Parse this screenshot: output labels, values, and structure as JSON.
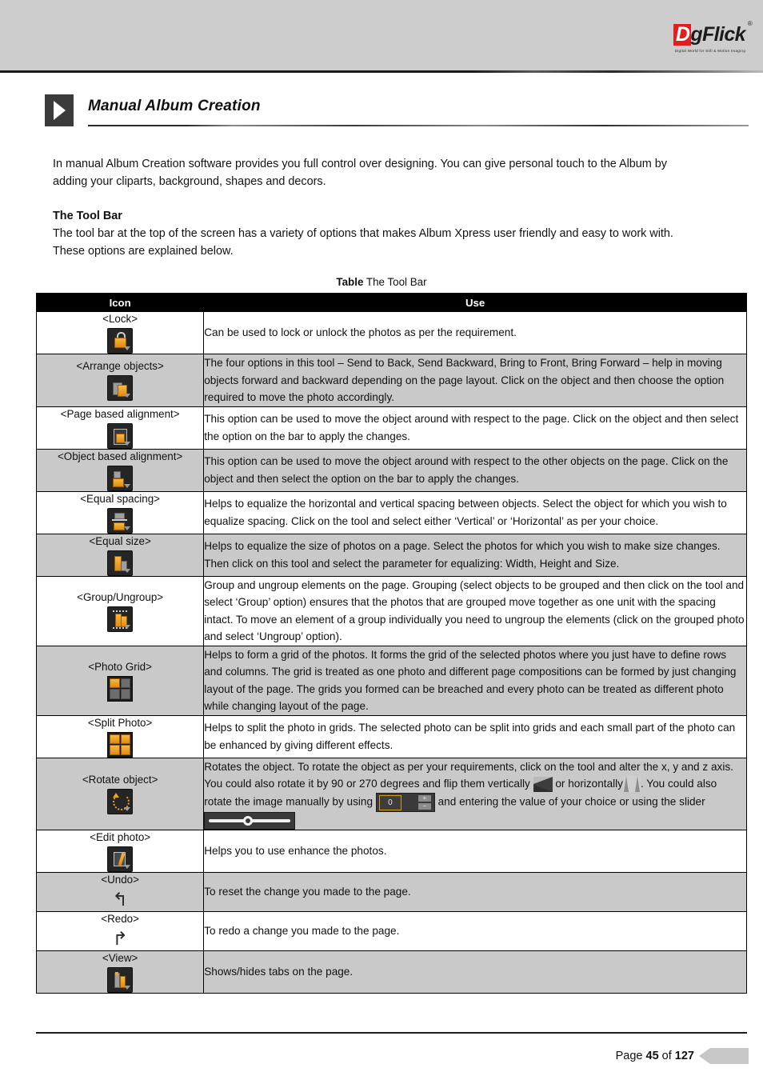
{
  "header": {
    "logo": {
      "first_letter": "D",
      "rest": "gFlick",
      "registered": "®",
      "tagline": "Digital World for Still & Motion Imaging"
    }
  },
  "chapter": {
    "title": "Manual Album Creation",
    "marker_icon": "play-triangle-icon"
  },
  "body": {
    "intro": "In manual Album Creation software provides you full control over designing. You can give personal touch to the Album by adding your cliparts, background, shapes and decors.",
    "toolbar_heading": "The Tool Bar",
    "toolbar_para": "The tool bar at the top of the screen has a variety of options that makes Album Xpress user friendly and easy to work with. These options are explained below."
  },
  "table": {
    "caption_bold": "Table",
    "caption_rest": " The Tool Bar",
    "columns": [
      "Icon",
      "Use"
    ],
    "rows": [
      {
        "label": "<Lock>",
        "icon": "lock-icon",
        "use": "Can be used to lock or unlock the photos as per the requirement."
      },
      {
        "label": "<Arrange objects>",
        "icon": "arrange-objects-icon",
        "use": "The four options in this tool – Send to Back, Send Backward, Bring to Front, Bring Forward – help in moving objects forward and backward depending on the page layout. Click on the object and then choose the option required to move the photo accordingly."
      },
      {
        "label": "<Page based alignment>",
        "icon": "page-based-alignment-icon",
        "use": "This option can be used to move the object around with respect to the page. Click on the object and then select the option on the bar to apply the changes."
      },
      {
        "label": "<Object based alignment>",
        "icon": "object-based-alignment-icon",
        "use": "This option can be used to move the object around with respect to the other objects on the page. Click on the object and then select the option on the bar to apply the changes."
      },
      {
        "label": "<Equal spacing>",
        "icon": "equal-spacing-icon",
        "use": "Helps to equalize the horizontal and vertical spacing between objects. Select the object for which you wish to equalize spacing. Click on the tool and select either ‘Vertical’ or ‘Horizontal’ as per your choice."
      },
      {
        "label": "<Equal size>",
        "icon": "equal-size-icon",
        "use": "Helps to equalize the size of photos on a page. Select the photos for which you wish to make size changes. Then click on this tool and select the parameter for equalizing: Width, Height and Size."
      },
      {
        "label": "<Group/Ungroup>",
        "icon": "group-ungroup-icon",
        "use": "Group and ungroup elements on the page. Grouping (select objects to be grouped and then click on the tool and select ‘Group’ option) ensures that the photos that are grouped move together as one unit with the spacing intact. To move an element of a group individually you need to ungroup the elements (click on the grouped photo and select ‘Ungroup’ option)."
      },
      {
        "label": "<Photo Grid>",
        "icon": "photo-grid-icon",
        "use": "Helps to form a grid of the photos. It forms the grid of the selected photos where you just have to define rows and columns. The grid is treated as one photo and different page compositions can be formed by just changing layout of the page. The grids you formed can be breached and every photo can be treated as different photo while changing layout of the page."
      },
      {
        "label": "<Split Photo>",
        "icon": "split-photo-icon",
        "use": "Helps to split the photo in grids. The selected photo can be split into grids and each small part of the photo can be enhanced by giving different effects."
      },
      {
        "label": "<Rotate object>",
        "icon": "rotate-object-icon",
        "use_segments": {
          "s1": "Rotates the object. To rotate the object as per your requirements, click on the tool and alter the x, y and z axis. You could also rotate it by 90 or 270 degrees and flip them vertically ",
          "s2": " or horizontally",
          "s3": ". You could also rotate the image manually by using ",
          "s4": " and entering the value of your choice or using the slider ",
          "spinner_value": "0",
          "spinner_up": "+",
          "spinner_down": "−"
        }
      },
      {
        "label": "<Edit photo>",
        "icon": "edit-photo-icon",
        "use": "Helps you to use enhance the photos."
      },
      {
        "label": "<Undo>",
        "icon": "undo-arrow-icon",
        "glyph": "↰",
        "use": "To reset the change you made to the page."
      },
      {
        "label": "<Redo>",
        "icon": "redo-arrow-icon",
        "glyph": "↱",
        "use": "To redo a change you made to the page."
      },
      {
        "label": "<View>",
        "icon": "view-icon",
        "use": "Shows/hides tabs on the page."
      }
    ]
  },
  "footer": {
    "page_prefix": "Page ",
    "page_number": "45",
    "page_mid": " of ",
    "page_total": "127"
  },
  "colors": {
    "accent_orange": "#f0a22a",
    "logo_red": "#e02020",
    "header_band": "#cdcdcd",
    "row_shade": "#c9c9c9"
  }
}
